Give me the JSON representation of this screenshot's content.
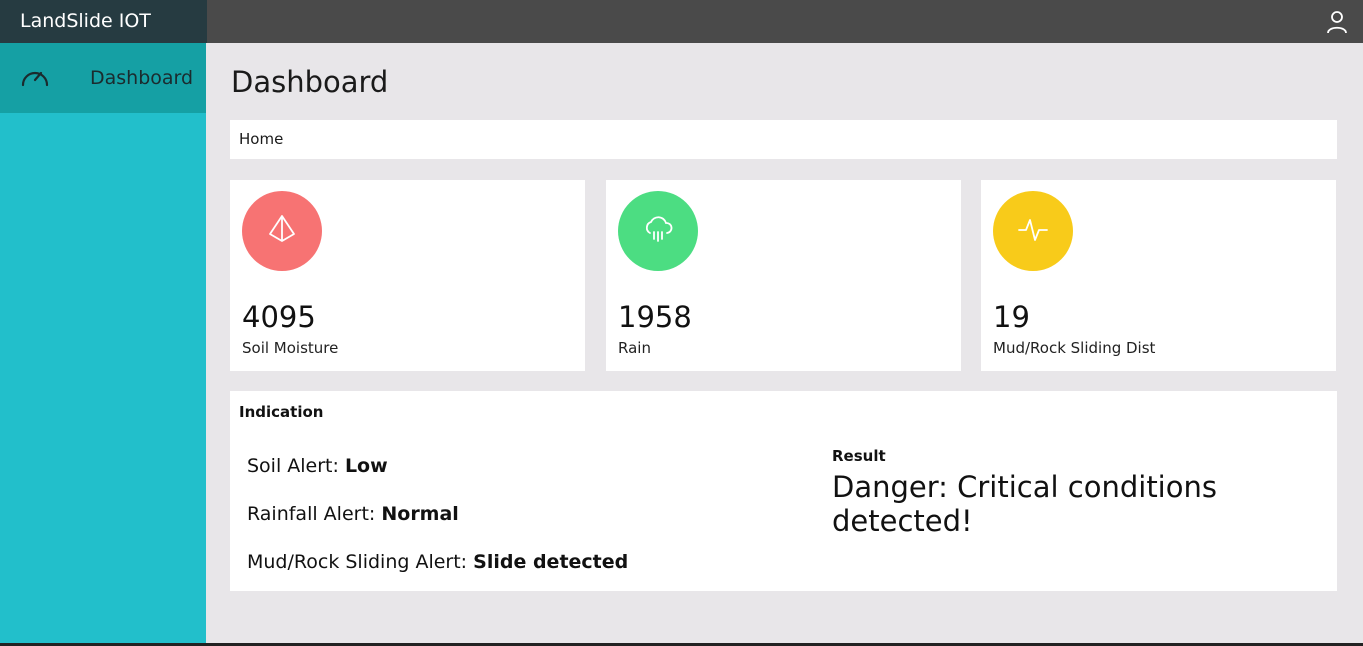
{
  "app": {
    "title": "LandSlide IOT"
  },
  "topbar": {
    "user_icon": "user-icon"
  },
  "sidebar": {
    "items": [
      {
        "label": "Dashboard",
        "icon": "speedometer-icon",
        "active": true
      }
    ]
  },
  "main": {
    "title": "Dashboard",
    "breadcrumb": "Home",
    "cards": [
      {
        "value": "4095",
        "label": "Soil Moisture",
        "icon": "diamond-icon",
        "color": "#f77373"
      },
      {
        "value": "1958",
        "label": "Rain",
        "icon": "rain-cloud-icon",
        "color": "#4cdd82"
      },
      {
        "value": "19",
        "label": "Mud/Rock Sliding Dist",
        "icon": "pulse-icon",
        "color": "#f8cb1a"
      }
    ],
    "indication": {
      "title": "Indication",
      "alerts": [
        {
          "label": "Soil Alert: ",
          "value": "Low"
        },
        {
          "label": "Rainfall Alert: ",
          "value": "Normal"
        },
        {
          "label": "Mud/Rock Sliding Alert: ",
          "value": "Slide detected"
        }
      ],
      "result_title": "Result",
      "result_text": "Danger: Critical conditions detected!"
    }
  },
  "colors": {
    "sidebar": "#22bfcb",
    "sidebar_active": "#15a0a4",
    "brand": "#263b41",
    "topbar": "#4a4a4a",
    "content_bg": "#e8e6e9"
  }
}
